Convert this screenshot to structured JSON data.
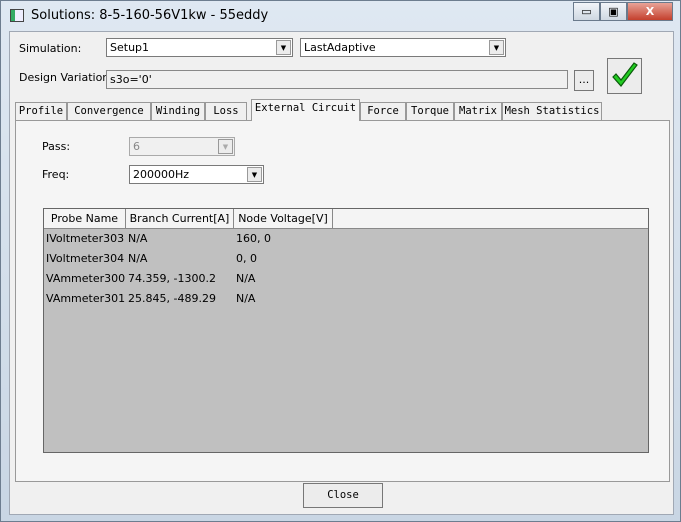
{
  "window": {
    "title": "Solutions: 8-5-160-56V1kw - 55eddy",
    "minimize": "▭",
    "maximize": "▣",
    "close": "X"
  },
  "simulation": {
    "label": "Simulation:",
    "setup": "Setup1",
    "solution": "LastAdaptive"
  },
  "design_variation": {
    "label": "Design Variation:",
    "value": "s3o='0'",
    "browse_label": "..."
  },
  "tabs": [
    "Profile",
    "Convergence",
    "Winding",
    "Loss",
    "External Circuit",
    "Force",
    "Torque",
    "Matrix",
    "Mesh Statistics"
  ],
  "active_tab": "External Circuit",
  "pass": {
    "label": "Pass:",
    "value": "6"
  },
  "freq": {
    "label": "Freq:",
    "value": "200000Hz"
  },
  "table": {
    "columns": [
      "Probe Name",
      "Branch Current[A]",
      "Node Voltage[V]"
    ],
    "rows": [
      [
        "IVoltmeter303",
        "N/A",
        "160, 0"
      ],
      [
        "IVoltmeter304",
        "N/A",
        "0, 0"
      ],
      [
        "VAmmeter300",
        "74.359, -1300.2",
        "N/A"
      ],
      [
        "VAmmeter301",
        "25.845, -489.29",
        "N/A"
      ]
    ]
  },
  "close_label": "Close",
  "colors": {
    "check": "#22cc22",
    "grid_bg": "#c0c0c0"
  }
}
